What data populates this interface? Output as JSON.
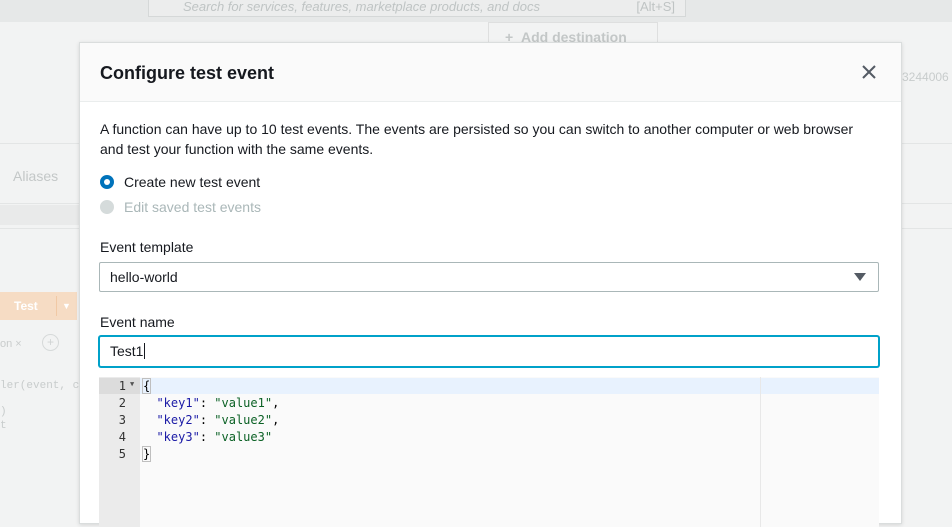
{
  "background": {
    "search_placeholder": "Search for services, features, marketplace products, and docs",
    "search_shortcut": "[Alt+S]",
    "add_destination_label": "Add destination",
    "arn_fragment": "3244006",
    "aliases_tab": "Aliases",
    "test_button_label": "Test",
    "editor_tab_fragment": "on",
    "code_fragment_1": "ler(event, c",
    "code_fragment_2": ")",
    "code_fragment_3": "t"
  },
  "modal": {
    "title": "Configure test event",
    "description": "A function can have up to 10 test events. The events are persisted so you can switch to another computer or web browser and test your function with the same events.",
    "options": [
      {
        "label": "Create new test event",
        "selected": true
      },
      {
        "label": "Edit saved test events",
        "selected": false
      }
    ],
    "template_label": "Event template",
    "template_value": "hello-world",
    "name_label": "Event name",
    "name_value": "Test1",
    "editor": {
      "line_numbers": [
        "1",
        "2",
        "3",
        "4",
        "5"
      ],
      "open_brace": "{",
      "close_brace": "}",
      "entries": [
        {
          "key": "\"key1\"",
          "value": "\"value1\"",
          "trail": ","
        },
        {
          "key": "\"key2\"",
          "value": "\"value2\"",
          "trail": ","
        },
        {
          "key": "\"key3\"",
          "value": "\"value3\"",
          "trail": ""
        }
      ]
    }
  },
  "colors": {
    "accent": "#0073bb",
    "focus": "#00a1c9",
    "json_key": "#1a1aa6",
    "json_value": "#0b6125"
  }
}
